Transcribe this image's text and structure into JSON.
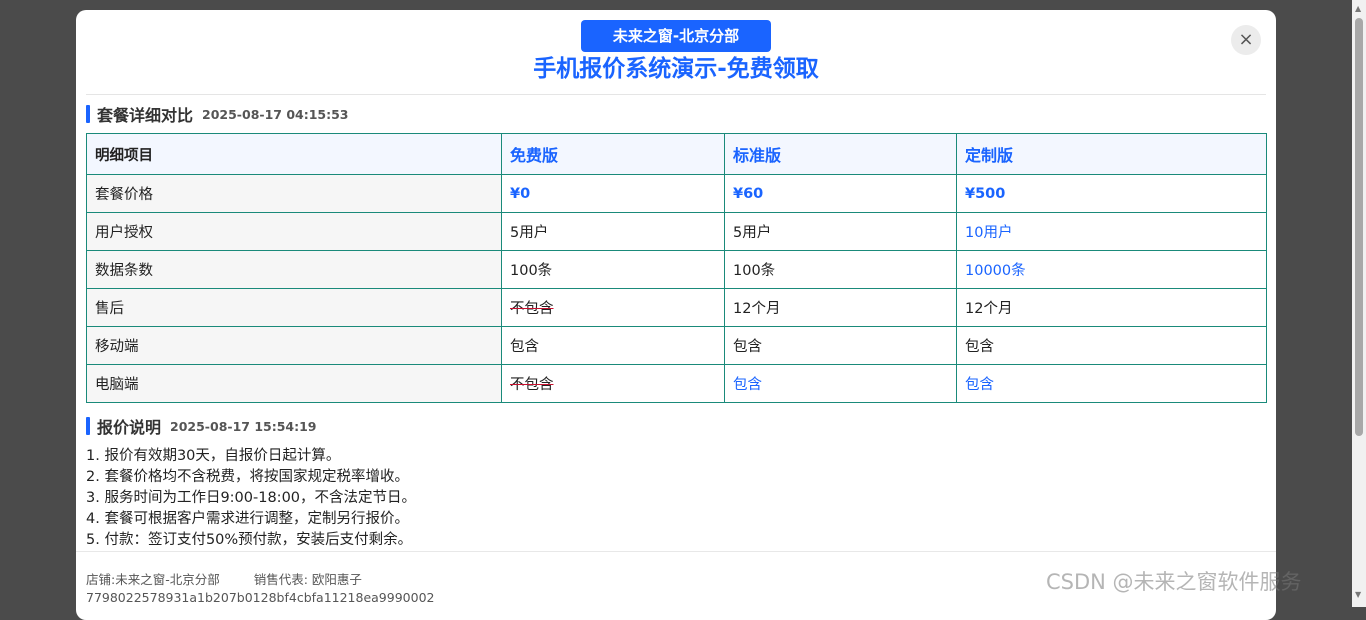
{
  "modal": {
    "badge": "未来之窗-北京分部",
    "title": "手机报价系统演示-免费领取",
    "close_label": "×"
  },
  "compare": {
    "heading": "套餐详细对比",
    "timestamp": "2025-08-17 04:15:53",
    "columns": [
      "明细项目",
      "免费版",
      "标准版",
      "定制版"
    ],
    "rows": [
      [
        "套餐价格",
        "¥0",
        "¥60",
        "¥500"
      ],
      [
        "用户授权",
        "5用户",
        "5用户",
        "10用户"
      ],
      [
        "数据条数",
        "100条",
        "100条",
        "10000条"
      ],
      [
        "售后",
        "不包含",
        "12个月",
        "12个月"
      ],
      [
        "移动端",
        "包含",
        "包含",
        "包含"
      ],
      [
        "电脑端",
        "不包含",
        "包含",
        "包含"
      ]
    ]
  },
  "quote": {
    "heading": "报价说明",
    "timestamp": "2025-08-17 15:54:19",
    "notes": [
      "1. 报价有效期30天，自报价日起计算。",
      "2. 套餐价格均不含税费，将按国家规定税率增收。",
      "3. 服务时间为工作日9:00-18:00，不含法定节日。",
      "4. 套餐可根据客户需求进行调整，定制另行报价。",
      "5. 付款：签订支付50%预付款，安装后支付剩余。"
    ]
  },
  "footer": {
    "store": "店铺:未来之窗-北京分部",
    "sales": "销售代表: 欧阳惠子",
    "id": "7798022578931a1b207b0128bf4cbfa11218ea9990002"
  },
  "watermark": "CSDN @未来之窗软件服务",
  "colors": {
    "accent": "#1a64ff",
    "table_border": "#1a8a7a",
    "strike": "#c8102e"
  }
}
